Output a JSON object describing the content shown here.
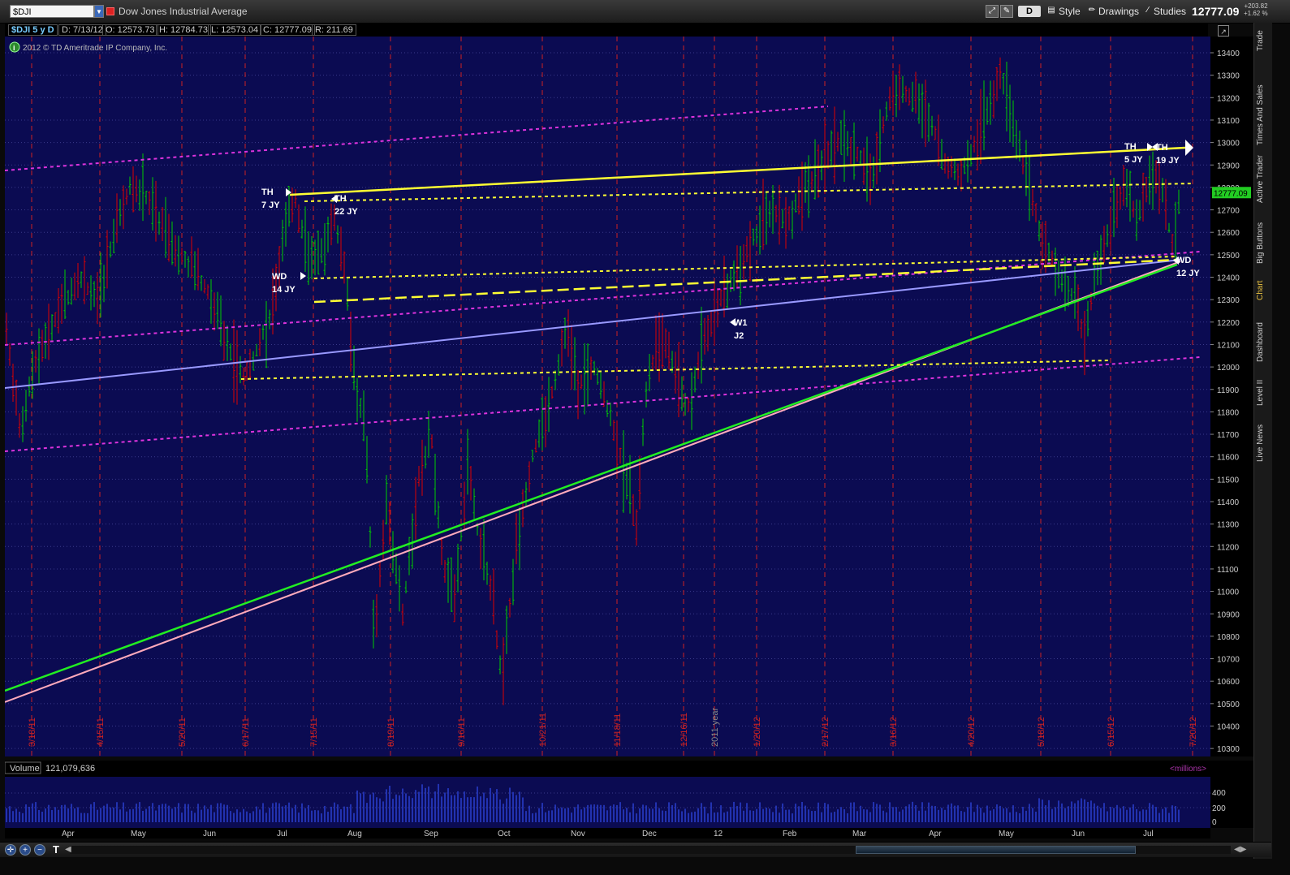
{
  "header": {
    "symbol": "$DJI",
    "description": "Dow Jones Industrial Average",
    "buttons": {
      "d": "D",
      "style": "Style",
      "drawings": "Drawings",
      "studies": "Studies"
    },
    "last_price": "12777.09",
    "net_change": "+203.82",
    "pct_change": "+1.62 %"
  },
  "info": {
    "title": "$DJI 5 y D",
    "date": "D: 7/13/12",
    "open": "O: 12573.73",
    "high": "H: 12784.73",
    "low": "L: 12573.04",
    "close": "C: 12777.09",
    "range": "R: 211.69"
  },
  "copyright": "2012 © TD Ameritrade IP Company, Inc.",
  "price_axis": {
    "ticks": [
      "13400",
      "13300",
      "13200",
      "13100",
      "13000",
      "12900",
      "12800",
      "12700",
      "12600",
      "12500",
      "12400",
      "12300",
      "12200",
      "12100",
      "12000",
      "11900",
      "11800",
      "11700",
      "11600",
      "11500",
      "11400",
      "11300",
      "11200",
      "11100",
      "11000",
      "10900",
      "10800",
      "10700",
      "10600",
      "10500",
      "10400",
      "10300"
    ],
    "current_badge": "12777.09"
  },
  "date_labels": [
    "3/18/11",
    "4/15/11",
    "5/20/11",
    "6/17/11",
    "7/15/11",
    "8/19/11",
    "9/16/11",
    "10/21/11",
    "11/18/11",
    "12/16/11",
    "2011 year",
    "1/20/12",
    "2/17/12",
    "3/16/12",
    "4/20/12",
    "5/18/12",
    "6/15/12",
    "7/20/12"
  ],
  "annotations": [
    {
      "l1": "TH",
      "l2": "7 JY"
    },
    {
      "l1": "TH",
      "l2": "22 JY"
    },
    {
      "l1": "WD",
      "l2": "14 JY"
    },
    {
      "l1": "W1",
      "l2": "J2"
    },
    {
      "l1": "TH",
      "l2": "5 JY"
    },
    {
      "l1": "TH",
      "l2": "19 JY"
    },
    {
      "l1": "WD",
      "l2": "12 JY"
    }
  ],
  "volume": {
    "label": "Volume",
    "value": "121,079,636",
    "units": "<millions>",
    "ticks": [
      "400",
      "200",
      "0"
    ]
  },
  "months": [
    "Apr",
    "May",
    "Jun",
    "Jul",
    "Aug",
    "Sep",
    "Oct",
    "Nov",
    "Dec",
    "12",
    "Feb",
    "Mar",
    "Apr",
    "May",
    "Jun",
    "Jul"
  ],
  "side_tabs": [
    "Trade",
    "Times And Sales",
    "Active Trader",
    "Big Buttons",
    "Chart",
    "Dashboard",
    "Level II",
    "Live News"
  ],
  "colors": {
    "background": "#0b0b52",
    "up_bar": "#00cc00",
    "down_bar": "#dd0000",
    "volume_bar": "#2a3fd0",
    "grid_red": "#cc2222",
    "trend_yellow": "#ffff33",
    "trend_green": "#22ee22",
    "trend_pink": "#ffaabb",
    "trend_lavender": "#9999ff",
    "channel_magenta": "#dd33dd"
  }
}
